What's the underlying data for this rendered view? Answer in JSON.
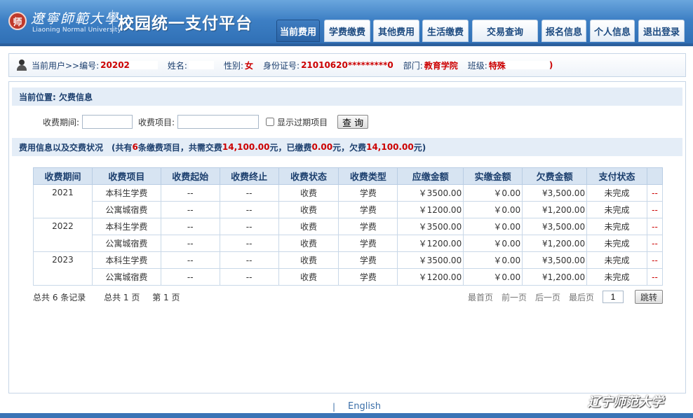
{
  "header": {
    "seal_char": "师",
    "logo_cn": "遼寧師範大學",
    "logo_en": "Liaoning Normal University",
    "title": "校园统一支付平台",
    "nav": [
      {
        "label": "当前费用",
        "active": true
      },
      {
        "label": "学费缴费"
      },
      {
        "label": "其他费用"
      },
      {
        "label": "生活缴费"
      },
      {
        "label": "交易查询"
      },
      {
        "label": "报名信息"
      },
      {
        "label": "个人信息"
      },
      {
        "label": "退出登录"
      }
    ]
  },
  "user": {
    "prefix": "当前用户>>编号:",
    "id": "20202",
    "name_label": "姓名:",
    "gender_label": "性别:",
    "gender": "女",
    "idcard_label": "身份证号:",
    "idcard": "21010620*********0",
    "dept_label": "部门:",
    "dept": "教育学院",
    "class_label": "班级:",
    "class_a": "特殊",
    "class_b": ")"
  },
  "crumb": "当前位置: 欠费信息",
  "filter": {
    "period_label": "收费期间:",
    "item_label": "收费项目:",
    "show_expired": "显示过期项目",
    "query_button": "查 询"
  },
  "fee_info": {
    "title": "费用信息以及交费状况",
    "p1": "(共有",
    "count": "6",
    "p2": "条缴费项目，共需交费",
    "total": "14,100.00",
    "p3": "元，已缴费",
    "paid": "0.00",
    "p4": "元，欠费",
    "owed": "14,100.00",
    "p5": "元)"
  },
  "table": {
    "headers": [
      "收费期间",
      "收费项目",
      "收费起始",
      "收费终止",
      "收费状态",
      "收费类型",
      "应缴金额",
      "实缴金额",
      "欠费金额",
      "支付状态"
    ],
    "groups": [
      {
        "year": "2021",
        "rows": [
          [
            "本科生学费",
            "--",
            "--",
            "收费",
            "学费",
            "￥3500.00",
            "￥0.00",
            "¥3,500.00",
            "未完成",
            "--"
          ],
          [
            "公寓城宿费",
            "--",
            "--",
            "收费",
            "学费",
            "￥1200.00",
            "￥0.00",
            "¥1,200.00",
            "未完成",
            "--"
          ]
        ]
      },
      {
        "year": "2022",
        "rows": [
          [
            "本科生学费",
            "--",
            "--",
            "收费",
            "学费",
            "￥3500.00",
            "￥0.00",
            "¥3,500.00",
            "未完成",
            "--"
          ],
          [
            "公寓城宿费",
            "--",
            "--",
            "收费",
            "学费",
            "￥1200.00",
            "￥0.00",
            "¥1,200.00",
            "未完成",
            "--"
          ]
        ]
      },
      {
        "year": "2023",
        "rows": [
          [
            "本科生学费",
            "--",
            "--",
            "收费",
            "学费",
            "￥3500.00",
            "￥0.00",
            "¥3,500.00",
            "未完成",
            "--"
          ],
          [
            "公寓城宿费",
            "--",
            "--",
            "收费",
            "学费",
            "￥1200.00",
            "￥0.00",
            "¥1,200.00",
            "未完成",
            "--"
          ]
        ]
      }
    ]
  },
  "pager": {
    "total_records": "总共 6 条记录",
    "total_pages": "总共 1 页",
    "current_page": "第 1 页",
    "first": "最首页",
    "prev": "前一页",
    "next": "后一页",
    "last": "最后页",
    "page_input": "1",
    "jump": "跳转"
  },
  "footer": {
    "separator": "|",
    "language": "English",
    "watermark": "辽宁师范大学"
  }
}
